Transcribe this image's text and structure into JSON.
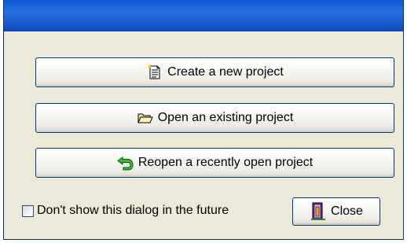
{
  "window": {
    "title": ""
  },
  "buttons": {
    "create_label": "Create a new project",
    "open_label": "Open an existing project",
    "reopen_label": "Reopen a recently open project",
    "close_label": "Close"
  },
  "options": {
    "dont_show_label": "Don't show this dialog in the future",
    "dont_show_checked": false
  },
  "icons": {
    "create": "new-document-icon",
    "open": "open-folder-icon",
    "reopen": "reopen-arrow-icon",
    "close": "exit-door-icon"
  },
  "colors": {
    "titlebar": "#0b58d2",
    "dialog_bg": "#ece9d8",
    "button_border": "#003c74"
  }
}
